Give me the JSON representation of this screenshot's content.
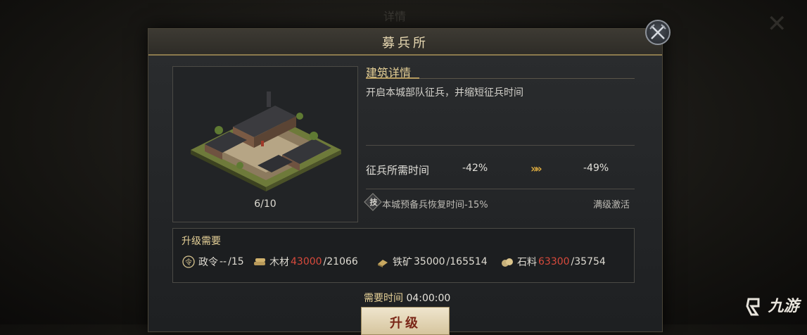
{
  "background": {
    "title": "详情"
  },
  "panel": {
    "title": "募兵所"
  },
  "building": {
    "level": "6/10"
  },
  "details": {
    "title": "建筑详情",
    "description": "开启本城部队征兵，并缩短征兵时间",
    "stat": {
      "label": "征兵所需时间",
      "current": "-42%",
      "arrow": "»»",
      "next": "-49%"
    },
    "skill": {
      "icon_glyph": "技",
      "text": "本城预备兵恢复时间-15%",
      "status": "满级激活"
    }
  },
  "requirements": {
    "title": "升级需要",
    "items": [
      {
        "name": "政令",
        "have": "--",
        "need": "/15",
        "icon": "decree-icon",
        "insufficient": false
      },
      {
        "name": "木材",
        "have": "43000",
        "need": "/21066",
        "icon": "wood-icon",
        "insufficient": true
      },
      {
        "name": "铁矿",
        "have": "35000",
        "need": "/165514",
        "icon": "iron-icon",
        "insufficient": false
      },
      {
        "name": "石料",
        "have": "63300",
        "need": "/35754",
        "icon": "stone-icon",
        "insufficient": true
      }
    ]
  },
  "time": {
    "label": "需要时间",
    "value": "04:00:00"
  },
  "upgrade_button": {
    "label": "升级"
  },
  "watermark": {
    "text": "九游"
  },
  "colors": {
    "accent_gold": "#e4cf96",
    "warning_red": "#d84a3c",
    "button_text": "#7a2617"
  }
}
